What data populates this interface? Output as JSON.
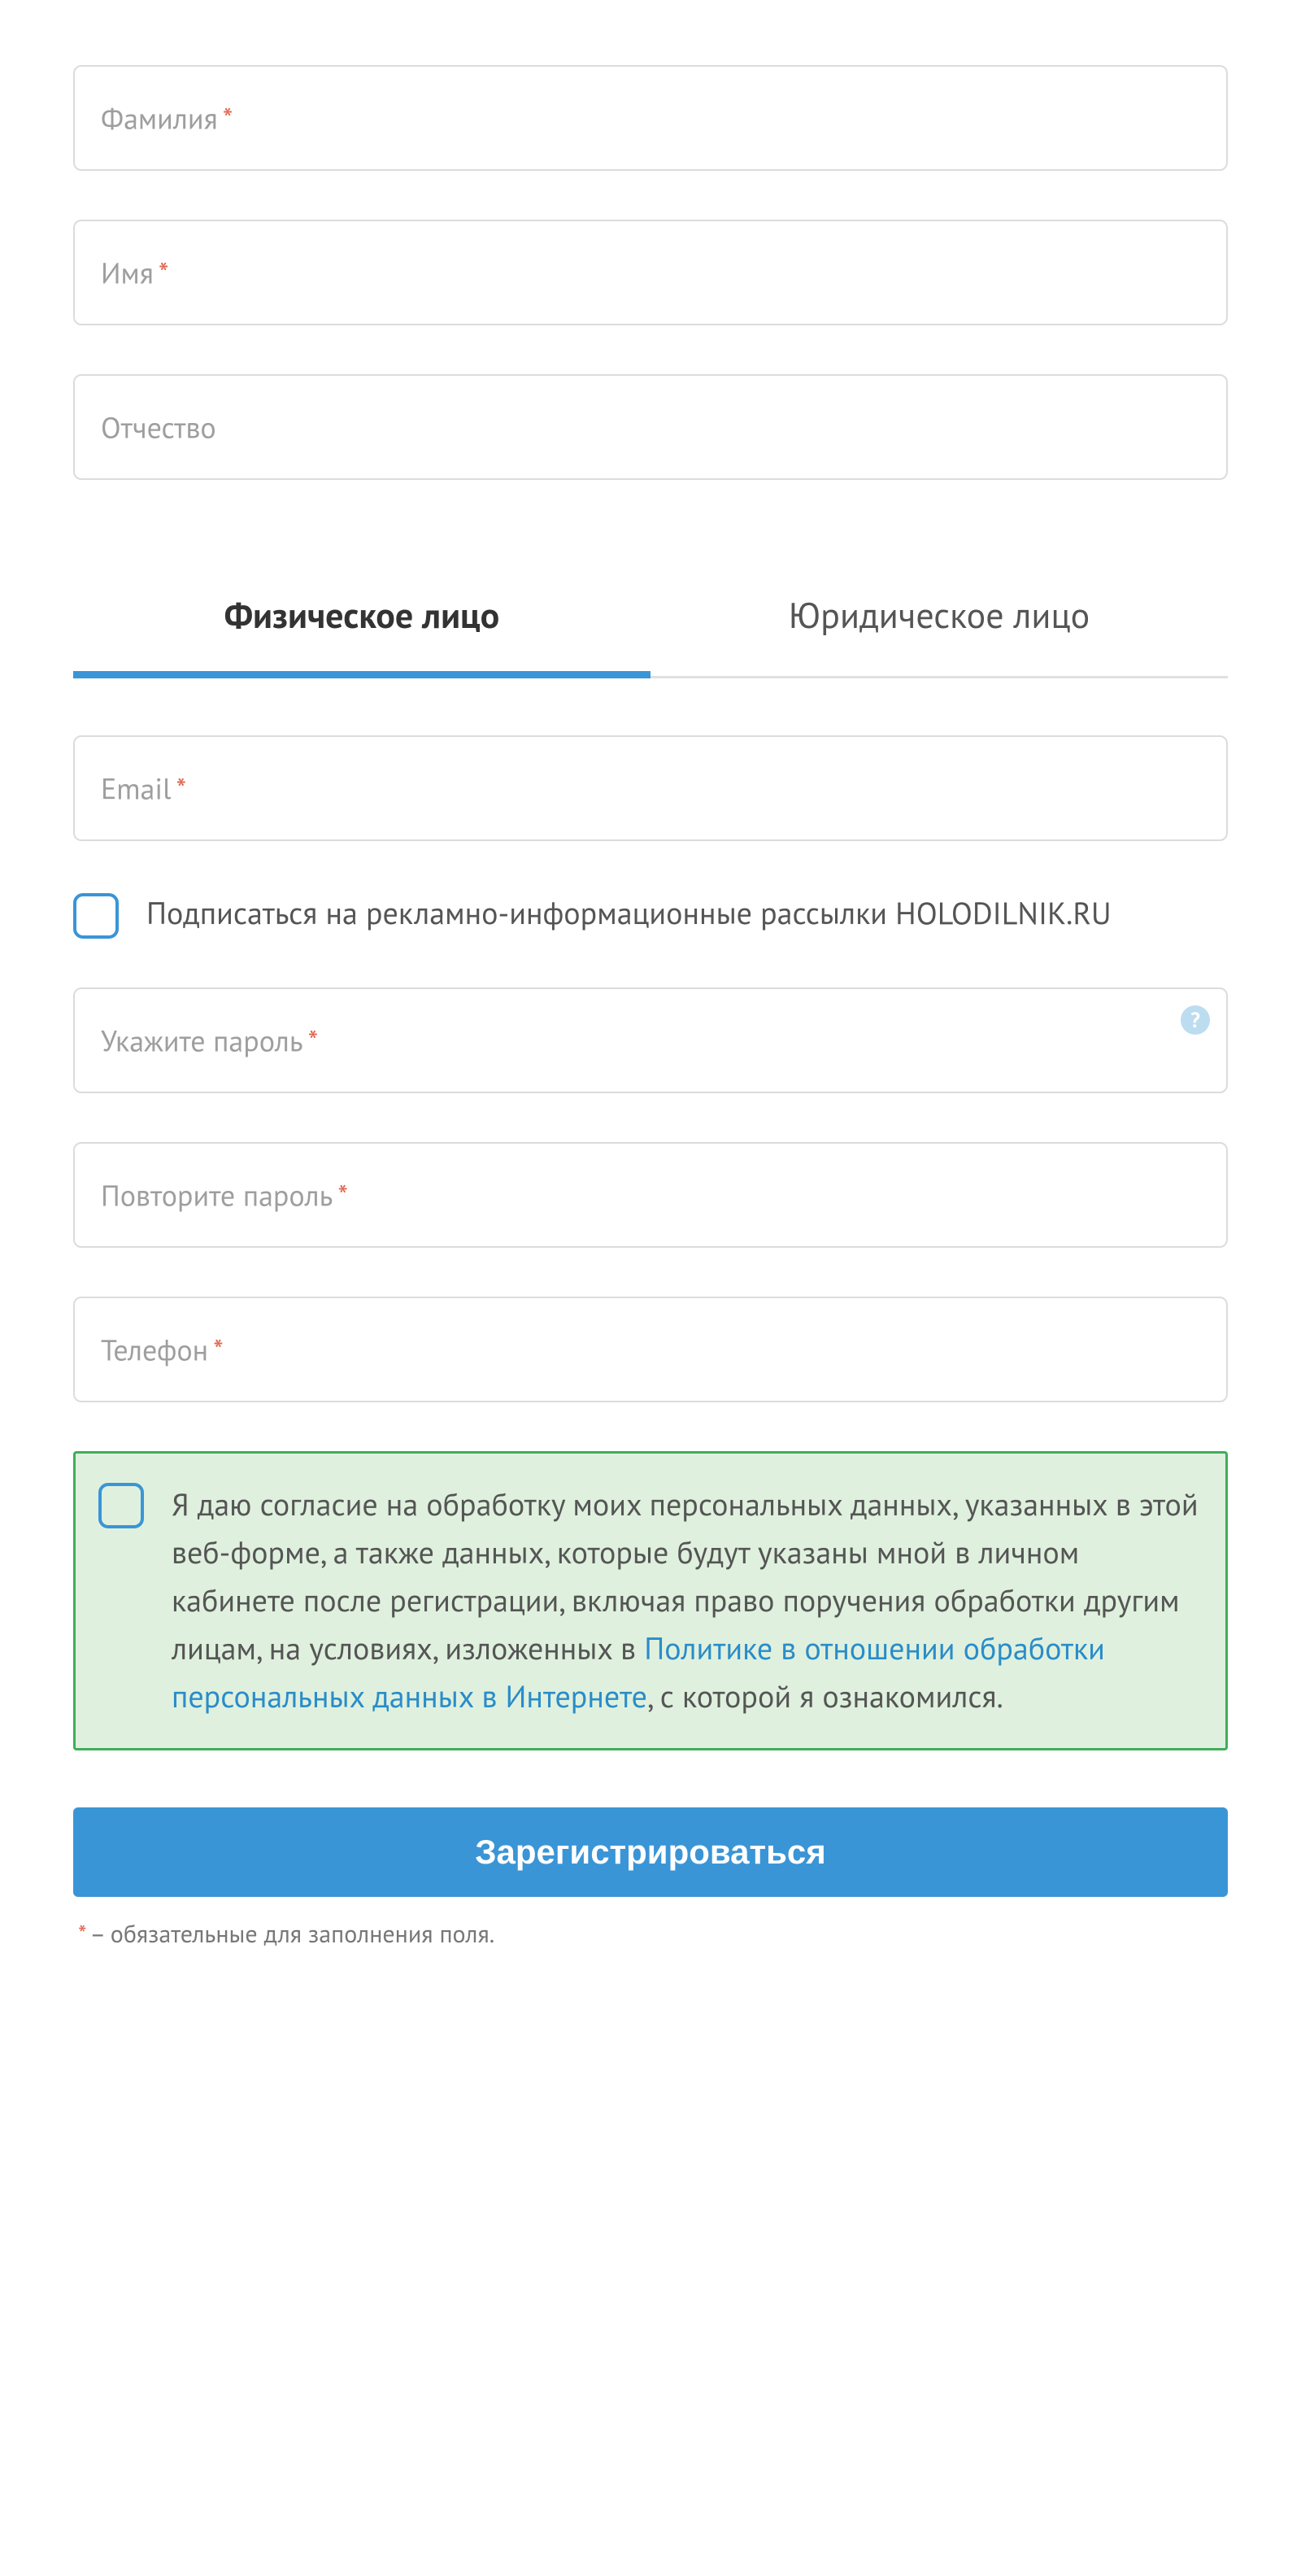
{
  "fields": {
    "lastname": {
      "label": "Фамилия",
      "required": true
    },
    "firstname": {
      "label": "Имя",
      "required": true
    },
    "patronymic": {
      "label": "Отчество",
      "required": false
    },
    "email": {
      "label": "Email",
      "required": true
    },
    "password": {
      "label": "Укажите пароль",
      "required": true
    },
    "password_repeat": {
      "label": "Повторите пароль",
      "required": true
    },
    "phone": {
      "label": "Телефон",
      "required": true
    }
  },
  "tabs": {
    "individual": "Физическое лицо",
    "legal": "Юридическое лицо"
  },
  "subscribe_label": "Подписаться на рекламно-информационные рассылки HOLODILNIK.RU",
  "consent": {
    "text_before": "Я даю согласие на обработку моих персональных данных, указанных в этой веб-форме, а также данных, которые будут указаны мной в личном кабинете после регистрации, включая право поручения обработки другим лицам, на условиях, изложенных в ",
    "link_text": "Политике в отношении обработки персональных данных в Интернете",
    "text_after": ", с которой я ознакомился."
  },
  "submit_label": "Зарегистрироваться",
  "required_note": " – обязательные для заполнения поля.",
  "required_asterisk": "*",
  "hint_icon": "?"
}
